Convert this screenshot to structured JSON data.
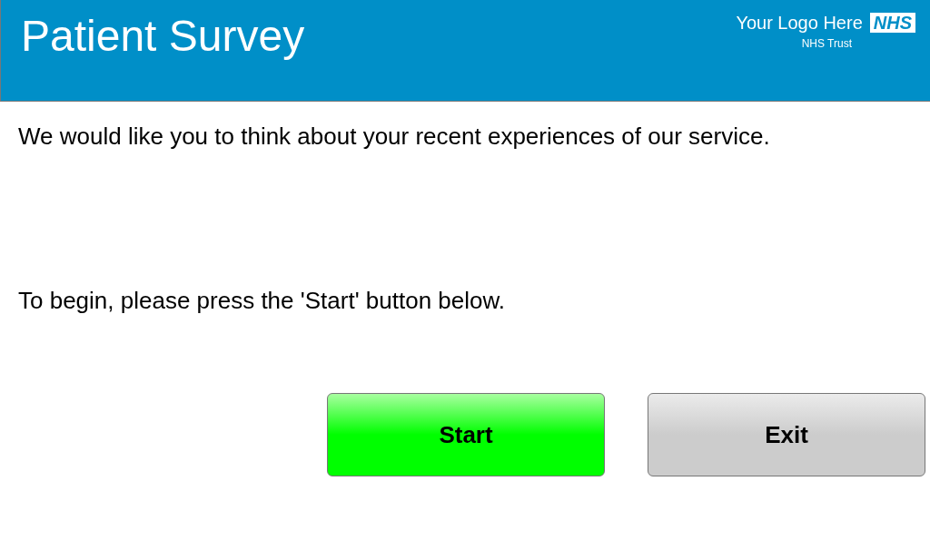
{
  "header": {
    "title": "Patient Survey",
    "logo": {
      "text": "Your Logo Here",
      "badge": "NHS",
      "subtitle": "NHS Trust"
    }
  },
  "intro": "We would like you to think about your recent experiences of our service.",
  "instruction": "To begin, please press the 'Start' button below.",
  "buttons": [
    {
      "label": "Start",
      "kind": "primary"
    },
    {
      "label": "Exit",
      "kind": "secondary"
    }
  ]
}
